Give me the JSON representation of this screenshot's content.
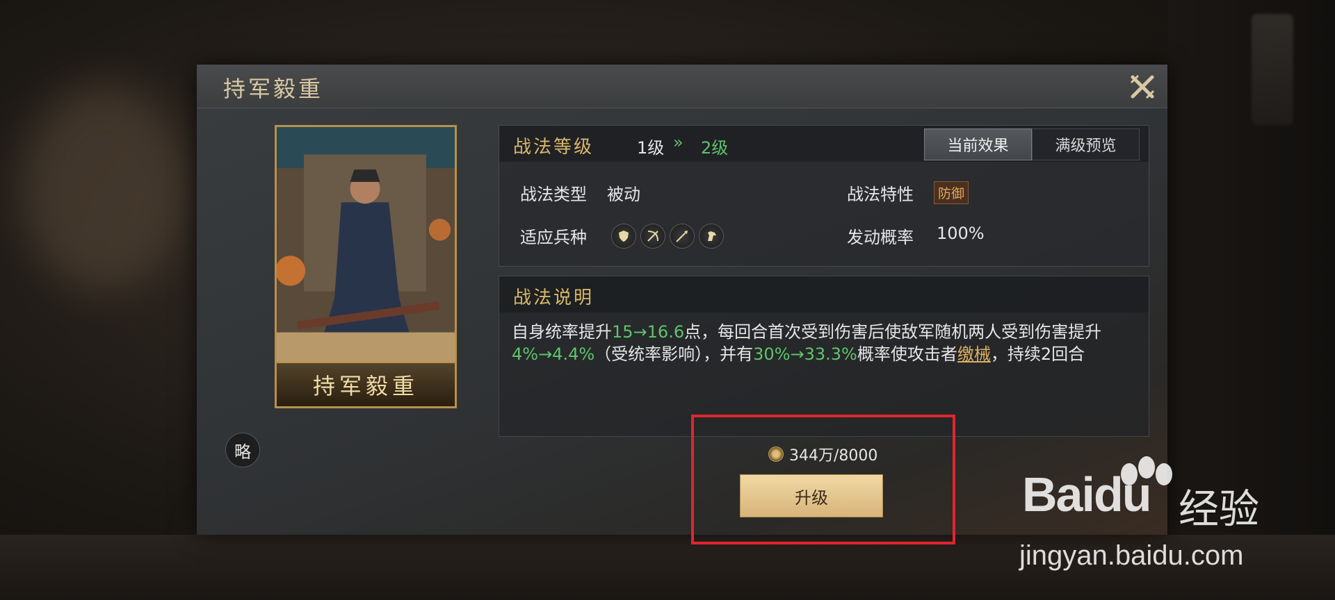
{
  "dialog": {
    "title": "持军毅重"
  },
  "card": {
    "name": "持军毅重"
  },
  "strategy_badge": "略",
  "level": {
    "label": "战法等级",
    "current": "1级",
    "arrow": "»",
    "next": "2级"
  },
  "tabs": [
    {
      "label": "当前效果",
      "active": true
    },
    {
      "label": "满级预览",
      "active": false
    }
  ],
  "attributes": {
    "type_label": "战法类型",
    "type_value": "被动",
    "trait_label": "战法特性",
    "trait_value": "防御",
    "troops_label": "适应兵种",
    "troop_icons": [
      "shield-icon",
      "bow-icon",
      "spear-icon",
      "horse-icon"
    ],
    "prob_label": "发动概率",
    "prob_value": "100%"
  },
  "description": {
    "title": "战法说明",
    "t1": "自身统率提升",
    "g1": "15→16.6",
    "t2": "点，每回合首次受到伤害后使敌军随机两人受到伤害提升",
    "g2": "4%→4.4%",
    "t3": "（受统率影响），并有",
    "g3": "30%→33.3%",
    "t4": "概率使攻击者",
    "k1": "缴械",
    "t5": "，持续2回合"
  },
  "upgrade": {
    "cost": "344万/8000",
    "button_label": "升级"
  },
  "watermark": {
    "logo_left": "Bai",
    "logo_right": "du",
    "cn": "经验",
    "url": "jingyan.baidu.com"
  },
  "colors": {
    "accent_gold": "#d9b86a",
    "green": "#5ec46a",
    "highlight_red": "#e0262b"
  }
}
